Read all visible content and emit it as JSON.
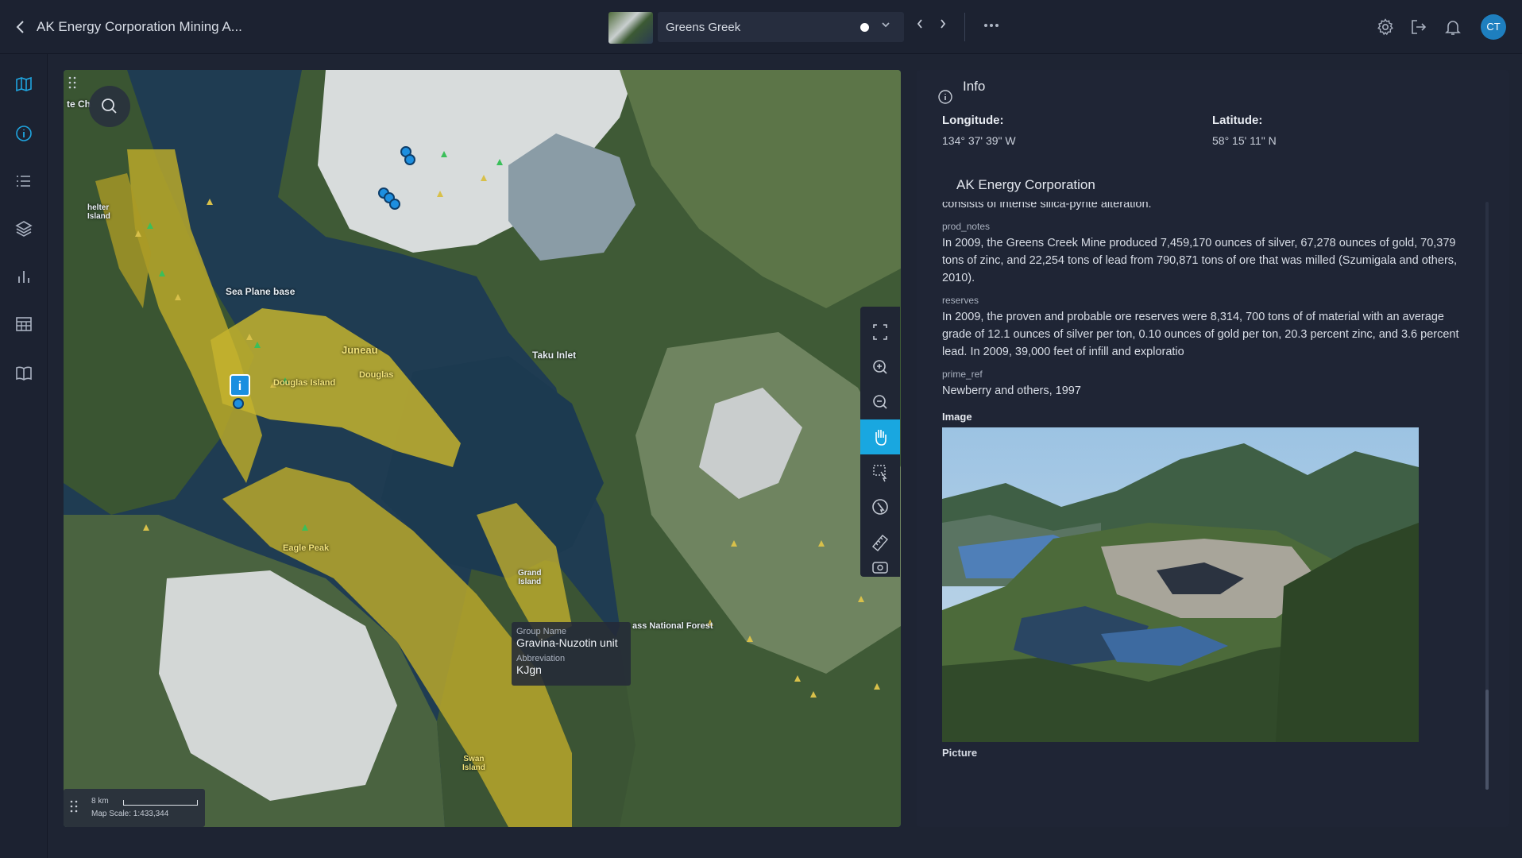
{
  "header": {
    "title": "AK Energy Corporation Mining A...",
    "layer_name": "Greens Greek",
    "avatar_initials": "CT"
  },
  "icons": {
    "back": "chevron-left-icon",
    "settings": "gear-icon",
    "logout": "logout-icon",
    "notifications": "bell-icon",
    "more": "more-icon"
  },
  "sidebar": {
    "items": [
      "map",
      "info",
      "list",
      "layers",
      "chart",
      "table",
      "book"
    ]
  },
  "map": {
    "labels": {
      "shelter_island": "helter\nIsland",
      "sea_plane": "Sea Plane base",
      "juneau": "Juneau",
      "douglas": "Douglas",
      "douglas_island": "Douglas Island",
      "taku_inlet": "Taku Inlet",
      "eagle_peak": "Eagle Peak",
      "grand_island": "Grand\nIsland",
      "national_forest": "ass National Forest",
      "swan_island": "Swan\nIsland",
      "te_ch": "te Ch"
    },
    "tooltip": {
      "group_key": "Group Name",
      "group_value": "Gravina-Nuzotin unit",
      "abbr_key": "Abbreviation",
      "abbr_value": "KJgn"
    },
    "scale": {
      "distance": "8 km",
      "text": "Map Scale: 1:433,344"
    },
    "info_marker": "i"
  },
  "info": {
    "title": "Info",
    "longitude_label": "Longitude:",
    "longitude": "134° 37' 39\" W",
    "latitude_label": "Latitude:",
    "latitude": "58° 15' 11\" N",
    "company": "AK Energy Corporation",
    "cut_text": "consists of intense silica-pyrite alteration.",
    "fields": [
      {
        "key": "prod_notes",
        "value": "In 2009, the Greens Creek Mine produced 7,459,170 ounces of silver, 67,278 ounces of gold, 70,379 tons of zinc, and 22,254 tons of lead from 790,871 tons of ore that was milled (Szumigala and others, 2010)."
      },
      {
        "key": "reserves",
        "value": "In 2009, the proven and probable ore reserves were 8,314, 700 tons of of material with an average grade of 12.1 ounces of silver per ton, 0.10 ounces of gold per ton, 20.3 percent zinc, and 3.6 percent lead. In 2009, 39,000 feet of infill and exploratio"
      },
      {
        "key": "prime_ref",
        "value": "Newberry and others, 1997"
      }
    ],
    "image_title": "Image",
    "image_caption": "Picture"
  }
}
